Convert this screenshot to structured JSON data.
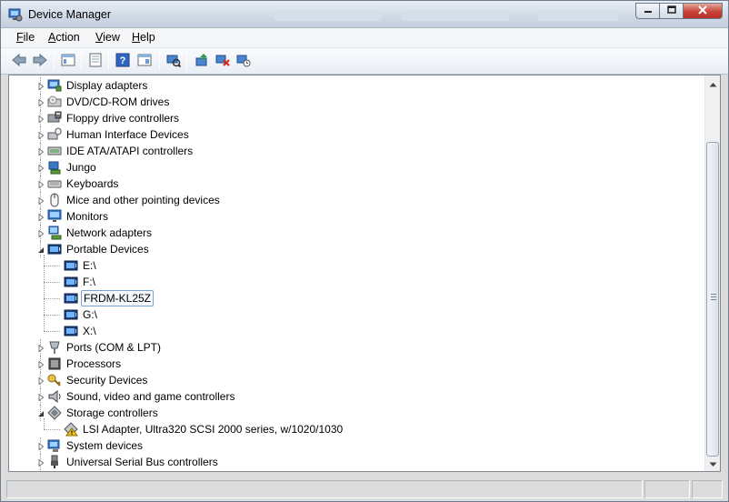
{
  "window": {
    "title": "Device Manager",
    "app_icon": "device-manager-icon"
  },
  "window_controls": {
    "minimize_icon": "minimize-icon",
    "maximize_icon": "maximize-icon",
    "close_icon": "close-icon"
  },
  "menu": {
    "items": [
      {
        "label": "File",
        "key": "F"
      },
      {
        "label": "Action",
        "key": "A"
      },
      {
        "label": "View",
        "key": "V"
      },
      {
        "label": "Help",
        "key": "H"
      }
    ]
  },
  "toolbar": {
    "buttons": [
      {
        "icon": "back-arrow-icon"
      },
      {
        "icon": "forward-arrow-icon"
      },
      {
        "icon": "show-hide-console-tree-icon"
      },
      {
        "icon": "properties-icon"
      },
      {
        "icon": "help-icon"
      },
      {
        "icon": "action-pane-icon"
      },
      {
        "icon": "scan-hardware-changes-icon"
      },
      {
        "icon": "update-driver-icon"
      },
      {
        "icon": "uninstall-icon"
      },
      {
        "icon": "disable-device-icon"
      }
    ]
  },
  "tree": {
    "items": [
      {
        "label": "Display adapters",
        "level": 0,
        "expanded": false,
        "icon": "display-adapter-icon"
      },
      {
        "label": "DVD/CD-ROM drives",
        "level": 0,
        "expanded": false,
        "icon": "dvd-drive-icon"
      },
      {
        "label": "Floppy drive controllers",
        "level": 0,
        "expanded": false,
        "icon": "floppy-controller-icon"
      },
      {
        "label": "Human Interface Devices",
        "level": 0,
        "expanded": false,
        "icon": "hid-icon"
      },
      {
        "label": "IDE ATA/ATAPI controllers",
        "level": 0,
        "expanded": false,
        "icon": "ide-controller-icon"
      },
      {
        "label": "Jungo",
        "level": 0,
        "expanded": false,
        "icon": "network-device-icon"
      },
      {
        "label": "Keyboards",
        "level": 0,
        "expanded": false,
        "icon": "keyboard-icon"
      },
      {
        "label": "Mice and other pointing devices",
        "level": 0,
        "expanded": false,
        "icon": "mouse-icon"
      },
      {
        "label": "Monitors",
        "level": 0,
        "expanded": false,
        "icon": "monitor-icon"
      },
      {
        "label": "Network adapters",
        "level": 0,
        "expanded": false,
        "icon": "network-adapter-icon"
      },
      {
        "label": "Portable Devices",
        "level": 0,
        "expanded": true,
        "icon": "portable-device-icon"
      },
      {
        "label": "E:\\",
        "level": 1,
        "icon": "portable-device-icon"
      },
      {
        "label": "F:\\",
        "level": 1,
        "icon": "portable-device-icon"
      },
      {
        "label": "FRDM-KL25Z",
        "level": 1,
        "icon": "portable-device-icon",
        "selected": true
      },
      {
        "label": "G:\\",
        "level": 1,
        "icon": "portable-device-icon"
      },
      {
        "label": "X:\\",
        "level": 1,
        "icon": "portable-device-icon"
      },
      {
        "label": "Ports (COM & LPT)",
        "level": 0,
        "expanded": false,
        "icon": "port-icon"
      },
      {
        "label": "Processors",
        "level": 0,
        "expanded": false,
        "icon": "processor-icon"
      },
      {
        "label": "Security Devices",
        "level": 0,
        "expanded": false,
        "icon": "key-icon"
      },
      {
        "label": "Sound, video and game controllers",
        "level": 0,
        "expanded": false,
        "icon": "speaker-icon"
      },
      {
        "label": "Storage controllers",
        "level": 0,
        "expanded": true,
        "icon": "storage-controller-icon"
      },
      {
        "label": "LSI Adapter, Ultra320 SCSI 2000 series, w/1020/1030",
        "level": 1,
        "icon": "warning-storage-icon"
      },
      {
        "label": "System devices",
        "level": 0,
        "expanded": false,
        "icon": "system-device-icon"
      },
      {
        "label": "Universal Serial Bus controllers",
        "level": 0,
        "expanded": false,
        "icon": "usb-icon"
      }
    ]
  },
  "colors": {
    "selection_border": "#7da2ce",
    "title_gradient_top": "#e8eef6",
    "close_button": "#c8443a"
  }
}
